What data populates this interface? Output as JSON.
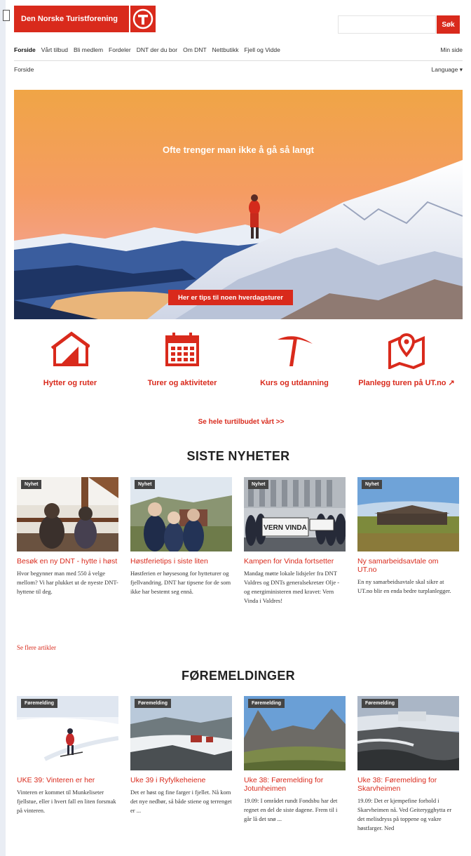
{
  "header": {
    "logo_text": "Den Norske Turistforening",
    "search_button": "Søk",
    "search_placeholder": ""
  },
  "nav": {
    "items": [
      "Forside",
      "Vårt tilbud",
      "Bli medlem",
      "Fordeler",
      "DNT der du bor",
      "Om DNT",
      "Nettbutikk",
      "Fjell og Vidde"
    ],
    "my_page": "Min side"
  },
  "breadcrumb": "Forside",
  "language": "Language ▾",
  "hero": {
    "title": "Ofte trenger man ikke å gå så langt",
    "button": "Her er tips til noen hverdagsturer"
  },
  "features": [
    {
      "label": "Hytter og ruter",
      "icon": "cabin-icon"
    },
    {
      "label": "Turer og aktiviteter",
      "icon": "calendar-icon"
    },
    {
      "label": "Kurs og utdanning",
      "icon": "ice-axe-icon"
    },
    {
      "label": "Planlegg turen på UT.no ↗",
      "icon": "map-pin-icon"
    }
  ],
  "all_offers": "Se hele turtilbudet vårt >>",
  "news": {
    "title": "SISTE NYHETER",
    "more": "Se flere artikler",
    "items": [
      {
        "badge": "Nyhet",
        "title": "Besøk en ny DNT - hytte i høst",
        "text": "Hvor begynner man med 550 å velge mellom? Vi har plukket ut de nyeste DNT-hyttene til deg."
      },
      {
        "badge": "Nyhet",
        "title": "Høstferietips i siste liten",
        "text": "Høstferien er høysesong for hytteturer og fjellvandring. DNT har tipsene for de som ikke har bestemt seg ennå."
      },
      {
        "badge": "Nyhet",
        "title": "Kampen for Vinda fortsetter",
        "text": "Mandag møtte lokale lidsjeler fra DNT Valdres og DNTs generalsekretær Olje - og energiministeren med kravet: Vern Vinda i Valdres!"
      },
      {
        "badge": "Nyhet",
        "title": "Ny samarbeidsavtale om UT.no",
        "text": "En ny samarbeidsavtale skal sikre at UT.no blir en enda bedre turplanlegger."
      }
    ]
  },
  "reports": {
    "title": "FØREMELDINGER",
    "items": [
      {
        "badge": "Føremelding",
        "title": "UKE 39: Vinteren er her",
        "text": "Vinteren er kommet til Munkeliseter fjellstue, eller i hvert fall en liten forsmak på vinteren."
      },
      {
        "badge": "Føremelding",
        "title": "Uke 39 i Ryfylkeheiene",
        "text": "Det er høst og fine farger i fjellet. Nå kom det nye nedbør, så både stiene og terrenget er ..."
      },
      {
        "badge": "Føremelding",
        "title": "Uke 38: Føremelding for Jotunheimen",
        "text": "19.09: I området rundt Fondsbu har det regnet en del de siste dagene. Frem til i går lå det snø ..."
      },
      {
        "badge": "Føremelding",
        "title": "Uke 38: Føremelding for Skarvheimen",
        "text": "19.09: Det er kjempefine forhold i Skarvheimen nå. Ved Geiterygghytta er det melisdryss på toppene og vakre høstfarger. Ned"
      }
    ]
  },
  "protest_banner": "VERN VINDA",
  "colors": {
    "brand_red": "#d92a1c",
    "badge": "#444444"
  }
}
